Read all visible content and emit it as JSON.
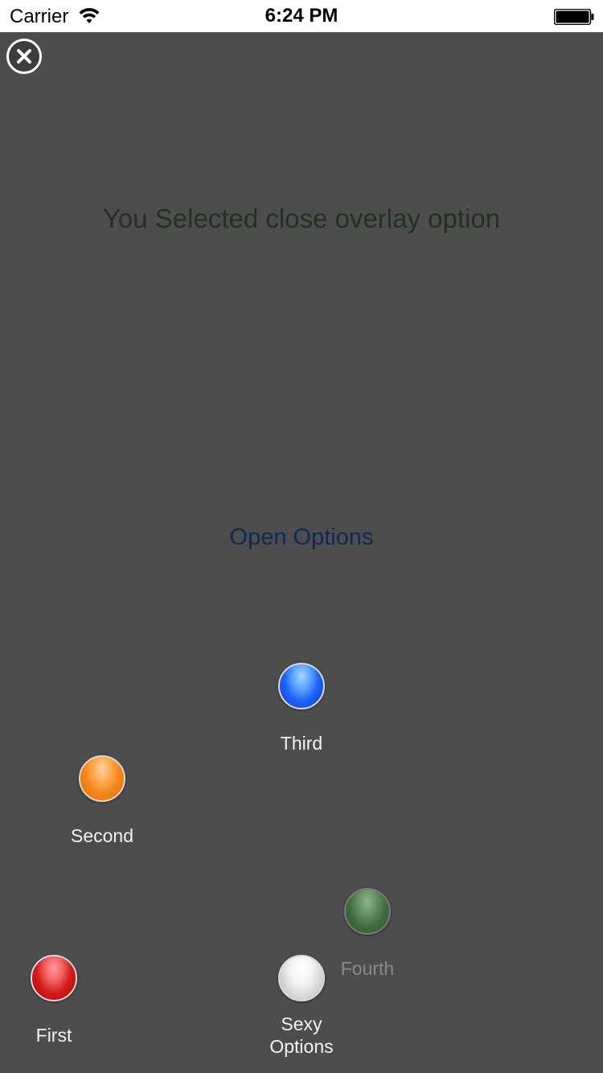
{
  "status_bar": {
    "carrier": "Carrier",
    "time": "6:24 PM"
  },
  "overlay": {
    "message": "You Selected close overlay option",
    "open_options_label": "Open Options"
  },
  "options": [
    {
      "label": "First",
      "color": "#d21e1e"
    },
    {
      "label": "Second",
      "color": "#f5871e"
    },
    {
      "label": "Third",
      "color": "#1f65f5"
    },
    {
      "label": "Fourth",
      "color": "#3e6b3e"
    },
    {
      "label": "Sexy Options",
      "color": "#d6d6d6"
    }
  ],
  "colors": {
    "overlay_background": "#4d4d4d",
    "message_text": "#213221",
    "link_text": "#0d2a55"
  }
}
